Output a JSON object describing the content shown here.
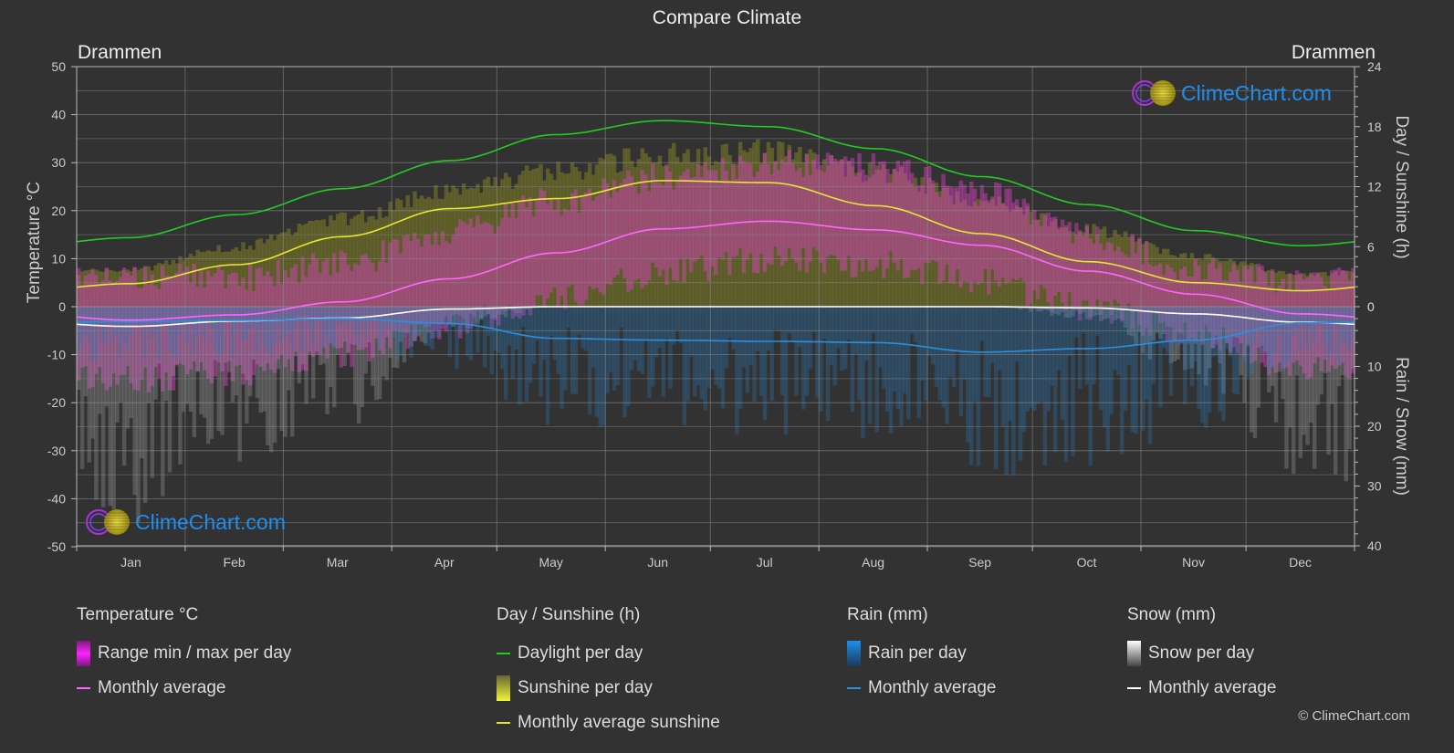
{
  "page": {
    "title": "Compare Climate",
    "city_left": "Drammen",
    "city_right": "Drammen",
    "watermark": "ClimeChart.com",
    "copyright": "© ClimeChart.com"
  },
  "legend": {
    "temperature": {
      "title": "Temperature °C",
      "items": [
        {
          "label": "Range min / max per day",
          "kind": "box",
          "color": "#e83ee8"
        },
        {
          "label": "Monthly average",
          "kind": "line",
          "color": "#ff66ff"
        }
      ]
    },
    "sun": {
      "title": "Day / Sunshine (h)",
      "items": [
        {
          "label": "Daylight per day",
          "kind": "line",
          "color": "#22cc22"
        },
        {
          "label": "Sunshine per day",
          "kind": "box",
          "color": "#e6e633"
        },
        {
          "label": "Monthly average sunshine",
          "kind": "line",
          "color": "#e6e633"
        }
      ]
    },
    "rain": {
      "title": "Rain (mm)",
      "items": [
        {
          "label": "Rain per day",
          "kind": "box",
          "color": "#1e8ee8"
        },
        {
          "label": "Monthly average",
          "kind": "line",
          "color": "#2a90e0"
        }
      ]
    },
    "snow": {
      "title": "Snow (mm)",
      "items": [
        {
          "label": "Snow per day",
          "kind": "box",
          "color": "#dddddd"
        },
        {
          "label": "Monthly average",
          "kind": "line",
          "color": "#ffffff"
        }
      ]
    }
  },
  "chart_data": {
    "type": "line",
    "title": "Compare Climate",
    "categories": [
      "Jan",
      "Feb",
      "Mar",
      "Apr",
      "May",
      "Jun",
      "Jul",
      "Aug",
      "Sep",
      "Oct",
      "Nov",
      "Dec"
    ],
    "axes": {
      "left": {
        "label": "Temperature °C",
        "range": [
          -50,
          50
        ],
        "ticks": [
          50,
          40,
          30,
          20,
          10,
          0,
          -10,
          -20,
          -30,
          -40,
          -50
        ]
      },
      "right_top": {
        "label": "Day / Sunshine (h)",
        "range": [
          0,
          24
        ],
        "ticks": [
          24,
          18,
          12,
          6,
          0
        ]
      },
      "right_bottom": {
        "label": "Rain / Snow (mm)",
        "range": [
          0,
          40
        ],
        "ticks": [
          0,
          10,
          20,
          30,
          40
        ]
      }
    },
    "grid": true,
    "series": [
      {
        "name": "Daylight per day",
        "unit": "h",
        "axis": "right_top",
        "color": "#22cc22",
        "values": [
          6.9,
          9.2,
          11.8,
          14.6,
          17.2,
          18.6,
          18.0,
          15.8,
          13.0,
          10.2,
          7.6,
          6.1
        ]
      },
      {
        "name": "Monthly average sunshine",
        "unit": "h",
        "axis": "right_top",
        "color": "#e6e633",
        "values": [
          2.3,
          4.2,
          7.0,
          9.8,
          10.8,
          12.6,
          12.4,
          10.1,
          7.3,
          4.5,
          2.4,
          1.6
        ]
      },
      {
        "name": "Temperature monthly average",
        "unit": "°C",
        "axis": "left",
        "color": "#ff66ff",
        "values": [
          -2.8,
          -1.7,
          1.0,
          5.8,
          11.2,
          16.2,
          17.8,
          16.0,
          12.8,
          7.4,
          2.6,
          -1.5
        ]
      },
      {
        "name": "Rain monthly average",
        "unit": "mm",
        "axis": "right_bottom",
        "color": "#2a90e0",
        "values": [
          2.5,
          2.3,
          2.0,
          2.8,
          5.3,
          5.6,
          5.8,
          6.0,
          7.6,
          7.0,
          5.6,
          2.7
        ]
      },
      {
        "name": "Snow monthly average",
        "unit": "mm",
        "axis": "right_bottom",
        "color": "#ffffff",
        "values": [
          3.3,
          2.4,
          1.9,
          0.4,
          0.0,
          0.0,
          0.0,
          0.0,
          0.0,
          0.2,
          1.2,
          2.6
        ]
      }
    ],
    "ranges": {
      "temp_daily_max": [
        6,
        6,
        9,
        15,
        22,
        27,
        30,
        29,
        24,
        15,
        8,
        5
      ],
      "temp_daily_min": [
        -15,
        -14,
        -10,
        -4,
        2,
        7,
        10,
        9,
        5,
        0,
        -6,
        -13
      ],
      "sunshine_envelope": [
        4.0,
        6.5,
        9.5,
        12.5,
        14.5,
        16.5,
        16.8,
        14.5,
        11.5,
        8.3,
        5.5,
        3.5
      ]
    }
  }
}
